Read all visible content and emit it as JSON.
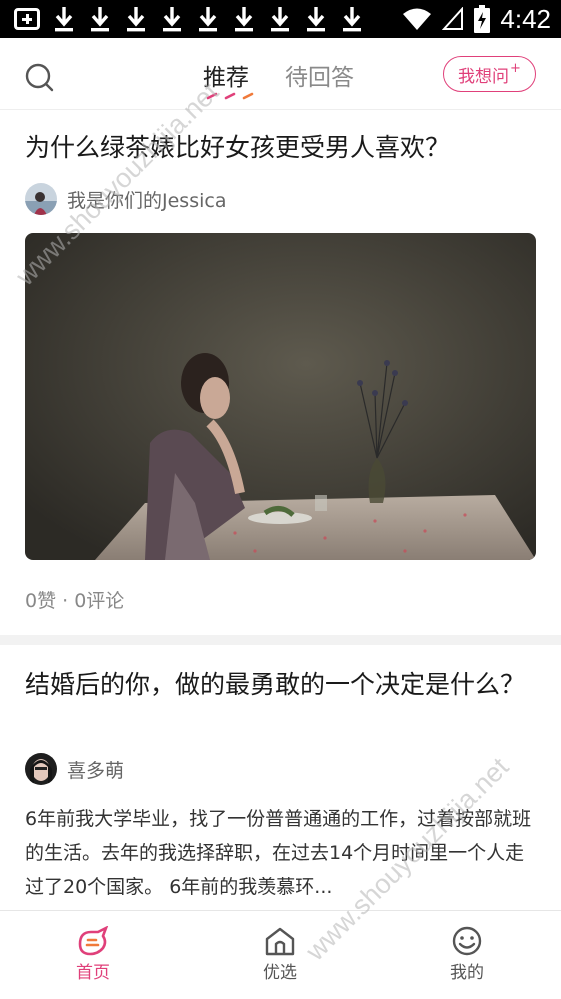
{
  "status_bar": {
    "time": "4:42",
    "icons": [
      "notification-plus-icon",
      "download-icon",
      "download-icon",
      "download-icon",
      "download-icon",
      "download-icon",
      "download-icon",
      "download-icon",
      "download-icon",
      "download-icon",
      "wifi-icon",
      "signal-icon",
      "battery-charging-icon"
    ]
  },
  "header": {
    "search_icon": "search-icon",
    "tabs": [
      {
        "label": "推荐",
        "active": true
      },
      {
        "label": "待回答",
        "active": false
      }
    ],
    "ask_button": {
      "label": "我想问",
      "badge": "+"
    }
  },
  "posts": [
    {
      "title": "为什么绿茶婊比好女孩更受男人喜欢？",
      "author": "我是你们的Jessica",
      "likes_comments": "0赞 · 0评论",
      "image": "woman-at-table-photo"
    },
    {
      "title": "结婚后的你，做的最勇敢的一个决定是什么？",
      "author": "喜多萌",
      "excerpt": "6年前我大学毕业，找了一份普普通通的工作，过着按部就班的生活。去年的我选择辞职，在过去14个月时间里一个人走过了20个国家。 6年前的我羡慕环..."
    }
  ],
  "bottom_nav": [
    {
      "label": "首页",
      "icon": "home-logo-icon",
      "active": true
    },
    {
      "label": "优选",
      "icon": "pick-house-icon",
      "active": false
    },
    {
      "label": "我的",
      "icon": "smiley-icon",
      "active": false
    }
  ],
  "watermark": {
    "text": "www.shouyouzhijia.net"
  },
  "colors": {
    "accent": "#e0407a",
    "tab_underline": [
      "#e0407a",
      "#f07a3a"
    ]
  }
}
